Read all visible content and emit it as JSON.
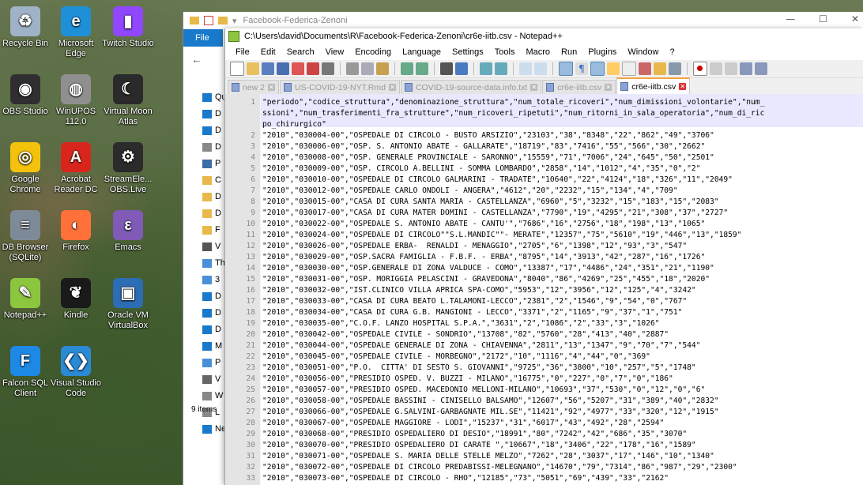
{
  "desktop": {
    "icons": [
      {
        "label": "Recycle Bin",
        "icon": "recycle-bin-icon",
        "color": "#9fb2c6"
      },
      {
        "label": "Microsoft Edge",
        "icon": "edge-icon",
        "color": "#1f8fd8"
      },
      {
        "label": "Twitch Studio",
        "icon": "twitch-icon",
        "color": "#9146ff"
      },
      {
        "label": "OBS Studio",
        "icon": "obs-icon",
        "color": "#302e31"
      },
      {
        "label": "WinUPOS 112.0",
        "icon": "globe-icon",
        "color": "#8f8f8f"
      },
      {
        "label": "Virtual Moon Atlas",
        "icon": "moon-icon",
        "color": "#2a2a2a"
      },
      {
        "label": "Google Chrome",
        "icon": "chrome-icon",
        "color": "#f4c20d"
      },
      {
        "label": "Acrobat Reader DC",
        "icon": "acrobat-icon",
        "color": "#d9261c"
      },
      {
        "label": "StreamEle... OBS.Live",
        "icon": "streamelements-icon",
        "color": "#2b2b2b"
      },
      {
        "label": "DB Browser (SQLite)",
        "icon": "database-icon",
        "color": "#7d8b99"
      },
      {
        "label": "Firefox",
        "icon": "firefox-icon",
        "color": "#ff7139"
      },
      {
        "label": "Emacs",
        "icon": "emacs-icon",
        "color": "#7f5ab6"
      },
      {
        "label": "Notepad++",
        "icon": "notepadpp-icon",
        "color": "#8cc63f"
      },
      {
        "label": "Kindle",
        "icon": "kindle-icon",
        "color": "#1a1a1a"
      },
      {
        "label": "Oracle VM VirtualBox",
        "icon": "virtualbox-icon",
        "color": "#2d6db5"
      },
      {
        "label": "Falcon SQL Client",
        "icon": "falcon-icon",
        "color": "#1e88e5"
      },
      {
        "label": "Visual Studio Code",
        "icon": "vscode-icon",
        "color": "#2a8ad4"
      }
    ]
  },
  "explorer": {
    "title": "Facebook-Federica-Zenoni",
    "ribbon_file": "File",
    "items_count": "9 items",
    "nav_labels": [
      "Qu",
      "D",
      "D",
      "D",
      "P",
      "C",
      "D",
      "D",
      "F",
      "V",
      "Thi",
      "3",
      "D",
      "D",
      "D",
      "M",
      "P",
      "V",
      "W",
      "L",
      "Ne"
    ]
  },
  "notepad": {
    "title": "C:\\Users\\david\\Documents\\R\\Facebook-Federica-Zenoni\\cr6e-iitb.csv - Notepad++",
    "menu": [
      "File",
      "Edit",
      "Search",
      "View",
      "Encoding",
      "Language",
      "Settings",
      "Tools",
      "Macro",
      "Run",
      "Plugins",
      "Window",
      "?"
    ],
    "tabs": [
      {
        "label": "new 2",
        "active": false
      },
      {
        "label": "US-COVID-19-NYT.Rmd",
        "active": false
      },
      {
        "label": "COVID-19-source-data.info.txt",
        "active": false
      },
      {
        "label": "cr6e-iitb.csv",
        "active": false
      },
      {
        "label": "cr6e-iitb.csv",
        "active": true
      }
    ],
    "lines": [
      {
        "n": "1",
        "text": "\"periodo\",\"codice_struttura\",\"denominazione_struttura\",\"num_totale_ricoveri\",\"num_dimissioni_volontarie\",\"num_"
      },
      {
        "n": "",
        "text": "ssioni\",\"num_trasferimenti_fra_strutture\",\"num_ricoveri_ripetuti\",\"num_ritorni_in_sala_operatoria\",\"num_di_ric"
      },
      {
        "n": "",
        "text": "po_chirurgico\""
      },
      {
        "n": "2",
        "text": "\"2010\",\"030004-00\",\"OSPEDALE DI CIRCOLO - BUSTO ARSIZIO\",\"23103\",\"38\",\"8348\",\"22\",\"862\",\"49\",\"3706\""
      },
      {
        "n": "3",
        "text": "\"2010\",\"030006-00\",\"OSP. S. ANTONIO ABATE - GALLARATE\",\"18719\",\"83\",\"7416\",\"55\",\"566\",\"30\",\"2662\""
      },
      {
        "n": "4",
        "text": "\"2010\",\"030008-00\",\"OSP. GENERALE PROVINCIALE - SARONNO\",\"15559\",\"71\",\"7006\",\"24\",\"645\",\"50\",\"2501\""
      },
      {
        "n": "5",
        "text": "\"2010\",\"030009-00\",\"OSP. CIRCOLO A.BELLINI - SOMMA LOMBARDO\",\"2858\",\"14\",\"1012\",\"4\",\"35\",\"0\",\"2\""
      },
      {
        "n": "6",
        "text": "\"2010\",\"030010-00\",\"OSPEDALE DI CIRCOLO GALMARINI - TRADATE\",\"10640\",\"22\",\"4124\",\"18\",\"326\",\"11\",\"2049\""
      },
      {
        "n": "7",
        "text": "\"2010\",\"030012-00\",\"OSPEDALE CARLO ONDOLI - ANGERA\",\"4612\",\"20\",\"2232\",\"15\",\"134\",\"4\",\"709\""
      },
      {
        "n": "8",
        "text": "\"2010\",\"030015-00\",\"CASA DI CURA SANTA MARIA - CASTELLANZA\",\"6960\",\"5\",\"3232\",\"15\",\"183\",\"15\",\"2083\""
      },
      {
        "n": "9",
        "text": "\"2010\",\"030017-00\",\"CASA DI CURA MATER DOMINI - CASTELLANZA\",\"7790\",\"19\",\"4295\",\"21\",\"308\",\"37\",\"2727\""
      },
      {
        "n": "10",
        "text": "\"2010\",\"030022-00\",\"OSPEDALE S. ANTONIO ABATE - CANTU'\",\"7686\",\"16\",\"2756\",\"18\",\"198\",\"13\",\"1065\""
      },
      {
        "n": "11",
        "text": "\"2010\",\"030024-00\",\"OSPEDALE DI CIRCOLO\"\"S.L.MANDIC\"\"- MERATE\",\"12357\",\"75\",\"5610\",\"19\",\"446\",\"13\",\"1859\""
      },
      {
        "n": "12",
        "text": "\"2010\",\"030026-00\",\"OSPEDALE ERBA-  RENALDI - MENAGGIO\",\"2705\",\"6\",\"1398\",\"12\",\"93\",\"3\",\"547\""
      },
      {
        "n": "13",
        "text": "\"2010\",\"030029-00\",\"OSP.SACRA FAMIGLIA - F.B.F. - ERBA\",\"8795\",\"14\",\"3913\",\"42\",\"287\",\"16\",\"1726\""
      },
      {
        "n": "14",
        "text": "\"2010\",\"030030-00\",\"OSP.GENERALE DI ZONA VALDUCE - COMO\",\"13387\",\"17\",\"4486\",\"24\",\"351\",\"21\",\"1190\""
      },
      {
        "n": "15",
        "text": "\"2010\",\"030031-00\",\"OSP. MORIGGIA PELASCINI - GRAVEDONA\",\"8040\",\"86\",\"4269\",\"25\",\"455\",\"18\",\"2020\""
      },
      {
        "n": "16",
        "text": "\"2010\",\"030032-00\",\"IST.CLINICO VILLA APRICA SPA-COMO\",\"5953\",\"12\",\"3956\",\"12\",\"125\",\"4\",\"3242\""
      },
      {
        "n": "17",
        "text": "\"2010\",\"030033-00\",\"CASA DI CURA BEATO L.TALAMONI-LECCO\",\"2381\",\"2\",\"1546\",\"9\",\"54\",\"0\",\"767\""
      },
      {
        "n": "18",
        "text": "\"2010\",\"030034-00\",\"CASA DI CURA G.B. MANGIONI - LECCO\",\"3371\",\"2\",\"1165\",\"9\",\"37\",\"1\",\"751\""
      },
      {
        "n": "19",
        "text": "\"2010\",\"030035-00\",\"C.O.F. LANZO HOSPITAL S.P.A.\",\"3631\",\"2\",\"1086\",\"2\",\"33\",\"3\",\"1026\""
      },
      {
        "n": "20",
        "text": "\"2010\",\"030042-00\",\"OSPEDALE CIVILE - SONDRIO\",\"13708\",\"82\",\"5760\",\"28\",\"413\",\"40\",\"2887\""
      },
      {
        "n": "21",
        "text": "\"2010\",\"030044-00\",\"OSPEDALE GENERALE DI ZONA - CHIAVENNA\",\"2811\",\"13\",\"1347\",\"9\",\"70\",\"7\",\"544\""
      },
      {
        "n": "22",
        "text": "\"2010\",\"030045-00\",\"OSPEDALE CIVILE - MORBEGNO\",\"2172\",\"10\",\"1116\",\"4\",\"44\",\"0\",\"369\""
      },
      {
        "n": "23",
        "text": "\"2010\",\"030051-00\",\"P.O.  CITTA' DI SESTO S. GIOVANNI\",\"9725\",\"36\",\"3800\",\"10\",\"257\",\"5\",\"1748\""
      },
      {
        "n": "24",
        "text": "\"2010\",\"030056-00\",\"PRESIDIO OSPED. V. BUZZI - MILANO\",\"16775\",\"0\",\"227\",\"0\",\"7\",\"0\",\"186\""
      },
      {
        "n": "25",
        "text": "\"2010\",\"030057-00\",\"PRESIDIO OSPED. MACEDONIO MELLONI-MILANO\",\"10693\",\"37\",\"530\",\"0\",\"12\",\"0\",\"6\""
      },
      {
        "n": "26",
        "text": "\"2010\",\"030058-00\",\"OSPEDALE BASSINI - CINISELLO BALSAMO\",\"12607\",\"56\",\"5207\",\"31\",\"389\",\"40\",\"2832\""
      },
      {
        "n": "27",
        "text": "\"2010\",\"030066-00\",\"OSPEDALE G.SALVINI-GARBAGNATE MIL.SE\",\"11421\",\"92\",\"4977\",\"33\",\"320\",\"12\",\"1915\""
      },
      {
        "n": "28",
        "text": "\"2010\",\"030067-00\",\"OSPEDALE MAGGIORE - LODI\",\"15237\",\"31\",\"6017\",\"43\",\"492\",\"28\",\"2594\""
      },
      {
        "n": "29",
        "text": "\"2010\",\"030068-00\",\"PRESIDIO OSPEDALIERO DI DESIO\",\"18991\",\"80\",\"7242\",\"42\",\"686\",\"35\",\"3070\""
      },
      {
        "n": "30",
        "text": "\"2010\",\"030070-00\",\"PRESIDIO OSPEDALIERO DI CARATE \",\"10667\",\"18\",\"3406\",\"22\",\"178\",\"16\",\"1589\""
      },
      {
        "n": "31",
        "text": "\"2010\",\"030071-00\",\"OSPEDALE S. MARIA DELLE STELLE MELZO\",\"7262\",\"28\",\"3037\",\"17\",\"146\",\"10\",\"1340\""
      },
      {
        "n": "32",
        "text": "\"2010\",\"030072-00\",\"OSPEDALE DI CIRCOLO PREDABISSI-MELEGNANO\",\"14670\",\"79\",\"7314\",\"86\",\"987\",\"29\",\"2300\""
      },
      {
        "n": "33",
        "text": "\"2010\",\"030073-00\",\"OSPEDALE DI CIRCOLO - RHO\",\"12185\",\"73\",\"5051\",\"69\",\"439\",\"33\",\"2162\""
      }
    ]
  }
}
